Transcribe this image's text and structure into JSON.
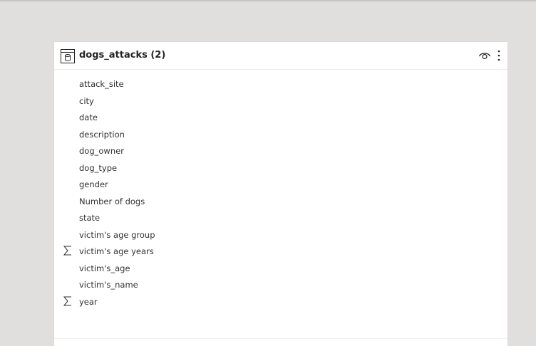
{
  "canvas": {
    "background": "#e1dfdd"
  },
  "table": {
    "name": "dogs_attacks (2)",
    "icon": "table-icon",
    "actions": {
      "visibility_icon": "eye-icon",
      "more_icon": "more-options-icon"
    },
    "fields": [
      {
        "label": "attack_site",
        "icon": ""
      },
      {
        "label": "city",
        "icon": ""
      },
      {
        "label": "date",
        "icon": ""
      },
      {
        "label": "description",
        "icon": ""
      },
      {
        "label": "dog_owner",
        "icon": ""
      },
      {
        "label": "dog_type",
        "icon": ""
      },
      {
        "label": "gender",
        "icon": ""
      },
      {
        "label": "Number of dogs",
        "icon": ""
      },
      {
        "label": "state",
        "icon": ""
      },
      {
        "label": "victim's age group",
        "icon": ""
      },
      {
        "label": "victim's age years",
        "icon": "sigma-icon"
      },
      {
        "label": "victim's_age",
        "icon": ""
      },
      {
        "label": "victim's_name",
        "icon": ""
      },
      {
        "label": "year",
        "icon": "sigma-icon"
      }
    ]
  }
}
